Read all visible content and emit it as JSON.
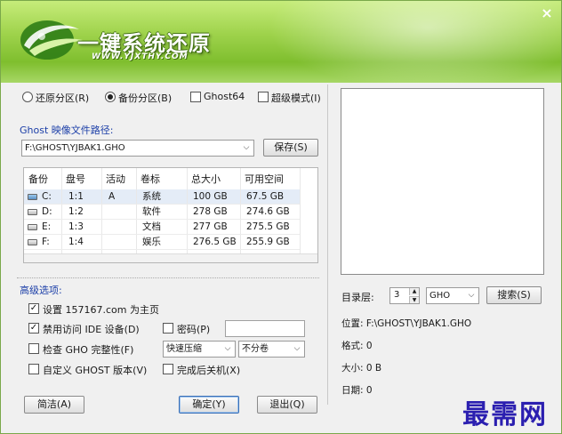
{
  "header": {
    "title": "一键系统还原",
    "url": "WWW.YJXTHY.COM",
    "close_glyph": "×"
  },
  "modes": {
    "restore_label": "还原分区(R)",
    "backup_label": "备份分区(B)",
    "ghost64_label": "Ghost64",
    "super_label": "超级模式(I)",
    "selected": "backup"
  },
  "path": {
    "label": "Ghost 映像文件路径:",
    "value": "F:\\GHOST\\YJBAK1.GHO",
    "save_label": "保存(S)"
  },
  "table": {
    "headers": [
      "备份",
      "盘号",
      "活动",
      "卷标",
      "总大小",
      "可用空间"
    ],
    "rows": [
      {
        "drive": "C:",
        "num": "1:1",
        "active": "A",
        "label": "系统",
        "total": "100 GB",
        "free": "67.5 GB"
      },
      {
        "drive": "D:",
        "num": "1:2",
        "active": "",
        "label": "软件",
        "total": "278 GB",
        "free": "274.6 GB"
      },
      {
        "drive": "E:",
        "num": "1:3",
        "active": "",
        "label": "文档",
        "total": "277 GB",
        "free": "275.5 GB"
      },
      {
        "drive": "F:",
        "num": "1:4",
        "active": "",
        "label": "娱乐",
        "total": "276.5 GB",
        "free": "255.9 GB"
      }
    ]
  },
  "advanced": {
    "title": "高级选项:",
    "homepage_label": "设置 157167.com 为主页",
    "disable_ide_label": "禁用访问 IDE 设备(D)",
    "password_label": "密码(P)",
    "check_gho_label": "检查 GHO 完整性(F)",
    "compress_value": "快速压缩",
    "split_value": "不分卷",
    "custom_ghost_label": "自定义 GHOST 版本(V)",
    "shutdown_label": "完成后关机(X)"
  },
  "right": {
    "dir_label": "目录层:",
    "dir_value": "3",
    "ext_value": "GHO",
    "search_label": "搜索(S)",
    "location_label": "位置: F:\\GHOST\\YJBAK1.GHO",
    "format_label": "格式: 0",
    "size_label": "大小: 0 B",
    "date_label": "日期: 0"
  },
  "buttons": {
    "simple_label": "简洁(A)",
    "ok_label": "确定(Y)",
    "exit_label": "退出(Q)"
  },
  "watermark": "最需网"
}
